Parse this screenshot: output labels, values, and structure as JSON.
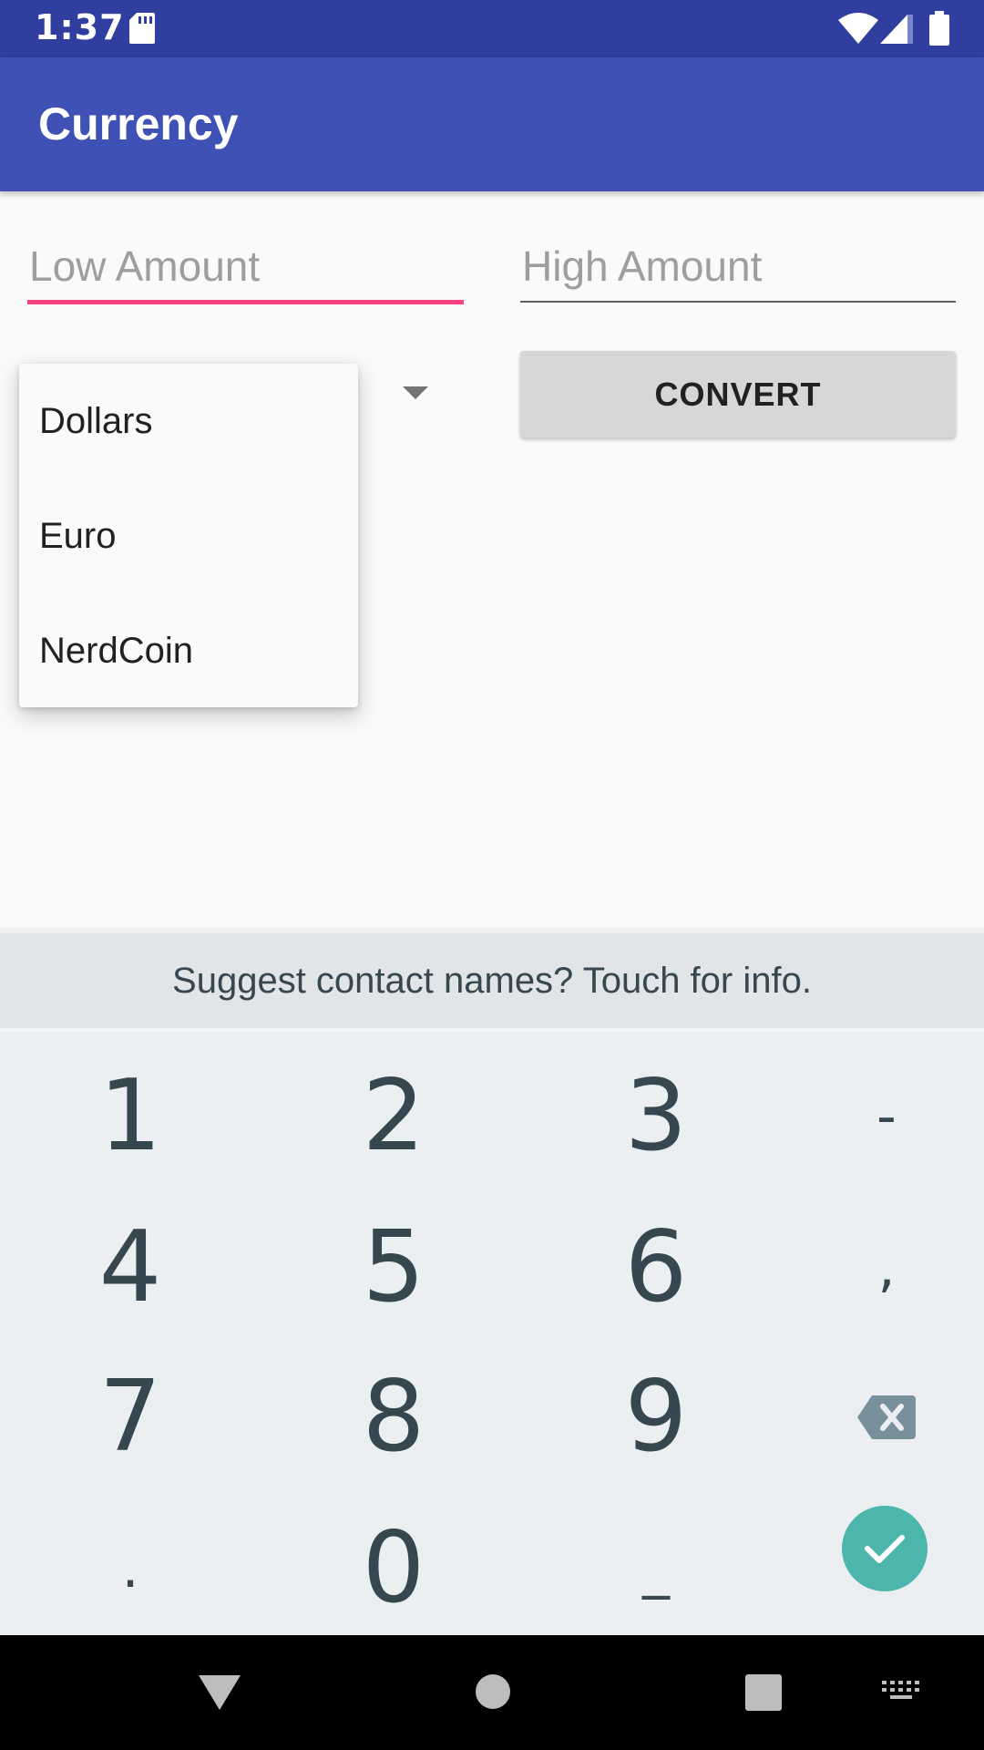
{
  "status_bar": {
    "time": "1:37"
  },
  "app_bar": {
    "title": "Currency"
  },
  "form": {
    "low_amount": {
      "value": "",
      "placeholder": "Low Amount"
    },
    "high_amount": {
      "value": "",
      "placeholder": "High Amount"
    },
    "convert_label": "CONVERT"
  },
  "currency_dropdown": {
    "options": [
      "Dollars",
      "Euro",
      "NerdCoin"
    ]
  },
  "keyboard": {
    "suggestion": "Suggest contact names? Touch for info.",
    "keys": [
      "1",
      "2",
      "3",
      "-",
      "4",
      "5",
      "6",
      ",",
      "7",
      "8",
      "9",
      "0",
      ".",
      "_"
    ]
  },
  "colors": {
    "status_bar": "#303f9f",
    "app_bar": "#3f51b5",
    "accent": "#ff4081",
    "done_key": "#4db6ac"
  },
  "icons": [
    "sd-card-icon",
    "wifi-icon",
    "cell-signal-icon",
    "battery-icon",
    "spinner-dropdown-arrow-icon",
    "backspace-icon",
    "checkmark-icon",
    "back-triangle-icon",
    "home-circle-icon",
    "recents-square-icon",
    "keyboard-switch-icon"
  ]
}
